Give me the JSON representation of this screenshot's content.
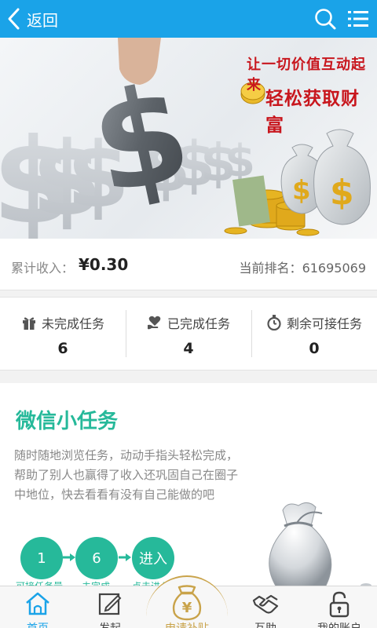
{
  "header": {
    "back_label": "返回",
    "back_icon": "chevron-left-icon",
    "search_icon": "search-icon",
    "menu_icon": "list-menu-icon"
  },
  "banner": {
    "slogan_line1": "让一切价值互动起来",
    "slogan_line2": "轻松获取财富"
  },
  "income": {
    "label": "累计收入：",
    "value": "¥0.30",
    "rank_label": "当前排名：",
    "rank_value": "61695069"
  },
  "stats": [
    {
      "icon": "gift-icon",
      "label": "未完成任务",
      "value": "6"
    },
    {
      "icon": "heart-hand-icon",
      "label": "已完成任务",
      "value": "4"
    },
    {
      "icon": "stopwatch-icon",
      "label": "剩余可接任务",
      "value": "0"
    }
  ],
  "task_card": {
    "title": "微信小任务",
    "description": "随时随地浏览任务，动动手指头轻松完成，帮助了别人也赢得了收入还巩固自己在圈子中地位，快去看看有没有自己能做的吧",
    "steps": [
      {
        "label": "1",
        "caption": "可接任务量"
      },
      {
        "label": "6",
        "caption": "未完成"
      },
      {
        "label": "进入",
        "caption": "点击进入"
      }
    ]
  },
  "bottom_nav": [
    {
      "label": "首页",
      "icon": "home-icon",
      "active": true
    },
    {
      "label": "发起",
      "icon": "edit-icon",
      "active": false
    },
    {
      "label": "申请补贴",
      "icon": "money-bag-icon",
      "active": false
    },
    {
      "label": "互助",
      "icon": "handshake-icon",
      "active": false
    },
    {
      "label": "我的账户",
      "icon": "lock-icon",
      "active": false
    }
  ],
  "colors": {
    "header": "#1aa3e8",
    "accent": "#26b99a",
    "slogan": "#c8161d",
    "gold": "#c9a34a"
  }
}
